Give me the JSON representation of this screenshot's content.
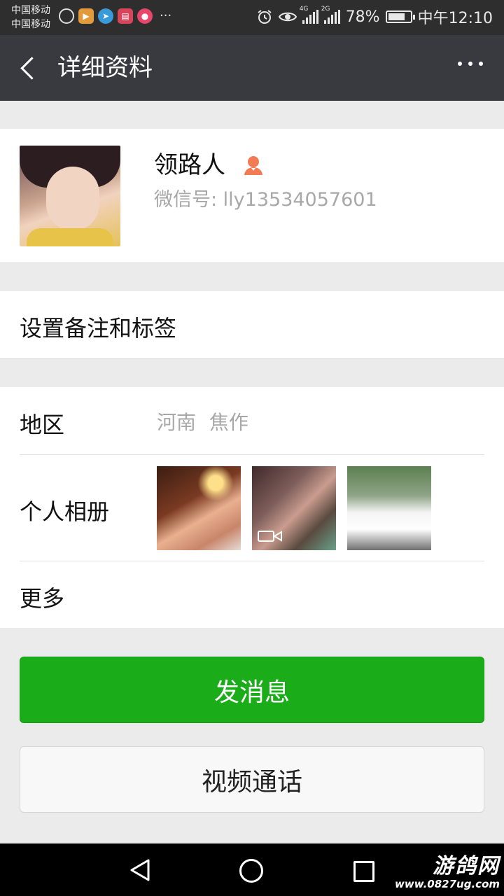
{
  "status_bar": {
    "carrier_1": "中国移动",
    "carrier_2": "中国移动",
    "more_notifications": "···",
    "network_1": "4G",
    "network_2": "2G",
    "battery_percent": "78%",
    "battery_level": 0.78,
    "time": "中午12:10"
  },
  "nav": {
    "title": "详细资料"
  },
  "profile": {
    "name": "领路人",
    "wechat_id": "微信号: lly13534057601",
    "gender_icon": "female-user-icon",
    "gender_color": "#f37b53"
  },
  "remark": {
    "label": "设置备注和标签"
  },
  "info": {
    "region_label": "地区",
    "region_value": "河南 焦作",
    "album_label": "个人相册",
    "more_label": "更多"
  },
  "actions": {
    "send_message": "发消息",
    "video_call": "视频通话",
    "send_color": "#1aad19"
  },
  "watermark": {
    "brand": "游鸽网",
    "url": "www.0827ug.com"
  }
}
